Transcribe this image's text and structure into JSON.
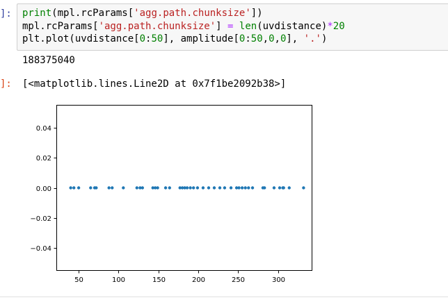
{
  "input_prompt": "]:",
  "output_prompt": "]:",
  "code_lines": [
    [
      {
        "t": "print",
        "c": "kw"
      },
      {
        "t": "(mpl.rcParams[",
        "c": ""
      },
      {
        "t": "'agg.path.chunksize'",
        "c": "st"
      },
      {
        "t": "])",
        "c": ""
      }
    ],
    [
      {
        "t": "mpl.rcParams[",
        "c": ""
      },
      {
        "t": "'agg.path.chunksize'",
        "c": "st"
      },
      {
        "t": "] ",
        "c": ""
      },
      {
        "t": "=",
        "c": "op"
      },
      {
        "t": " ",
        "c": ""
      },
      {
        "t": "len",
        "c": "kw"
      },
      {
        "t": "(uvdistance)",
        "c": ""
      },
      {
        "t": "*",
        "c": "op"
      },
      {
        "t": "20",
        "c": "nu"
      }
    ],
    [
      {
        "t": "plt.plot(uvdistance[",
        "c": ""
      },
      {
        "t": "0",
        "c": "nu"
      },
      {
        "t": ":",
        "c": ""
      },
      {
        "t": "50",
        "c": "nu"
      },
      {
        "t": "], amplitude[",
        "c": ""
      },
      {
        "t": "0",
        "c": "nu"
      },
      {
        "t": ":",
        "c": ""
      },
      {
        "t": "50",
        "c": "nu"
      },
      {
        "t": ",",
        "c": ""
      },
      {
        "t": "0",
        "c": "nu"
      },
      {
        "t": ",",
        "c": ""
      },
      {
        "t": "0",
        "c": "nu"
      },
      {
        "t": "], ",
        "c": ""
      },
      {
        "t": "'.'",
        "c": "st"
      },
      {
        "t": ")",
        "c": ""
      }
    ]
  ],
  "stream_output": "188375040",
  "result_output": "[<matplotlib.lines.Line2D at 0x7f1be2092b38>]",
  "colors": {
    "keyword": "#008000",
    "string": "#ba2121",
    "number": "#008000",
    "operator": "#aa22ff",
    "marker": "#1f77b4"
  },
  "chart_data": {
    "type": "scatter",
    "title": "",
    "xlabel": "",
    "ylabel": "",
    "xlim": [
      22,
      343
    ],
    "ylim": [
      -0.055,
      0.055
    ],
    "xticks": [
      50,
      100,
      150,
      200,
      250,
      300
    ],
    "xtick_labels": [
      "50",
      "100",
      "150",
      "200",
      "250",
      "300"
    ],
    "yticks": [
      0.04,
      0.02,
      0.0,
      -0.02,
      -0.04
    ],
    "ytick_labels": [
      "0.04",
      "0.02",
      "0.00",
      "−0.02",
      "−0.04"
    ],
    "grid": false,
    "legend": "none",
    "series": [
      {
        "marker": ".",
        "x": [
          40,
          44,
          50,
          65,
          70,
          72,
          88,
          92,
          106,
          123,
          127,
          130,
          143,
          146,
          149,
          159,
          164,
          177,
          180,
          183,
          186,
          190,
          194,
          199,
          206,
          213,
          220,
          227,
          233,
          241,
          248,
          251,
          255,
          259,
          263,
          268,
          281,
          283,
          295,
          302,
          306,
          307,
          314,
          332
        ],
        "y": [
          0,
          0,
          0,
          0,
          0,
          0,
          0,
          0,
          0,
          0,
          0,
          0,
          0,
          0,
          0,
          0,
          0,
          0,
          0,
          0,
          0,
          0,
          0,
          0,
          0,
          0,
          0,
          0,
          0,
          0,
          0,
          0,
          0,
          0,
          0,
          0,
          0,
          0,
          0,
          0,
          0,
          0,
          0,
          0
        ]
      }
    ]
  }
}
